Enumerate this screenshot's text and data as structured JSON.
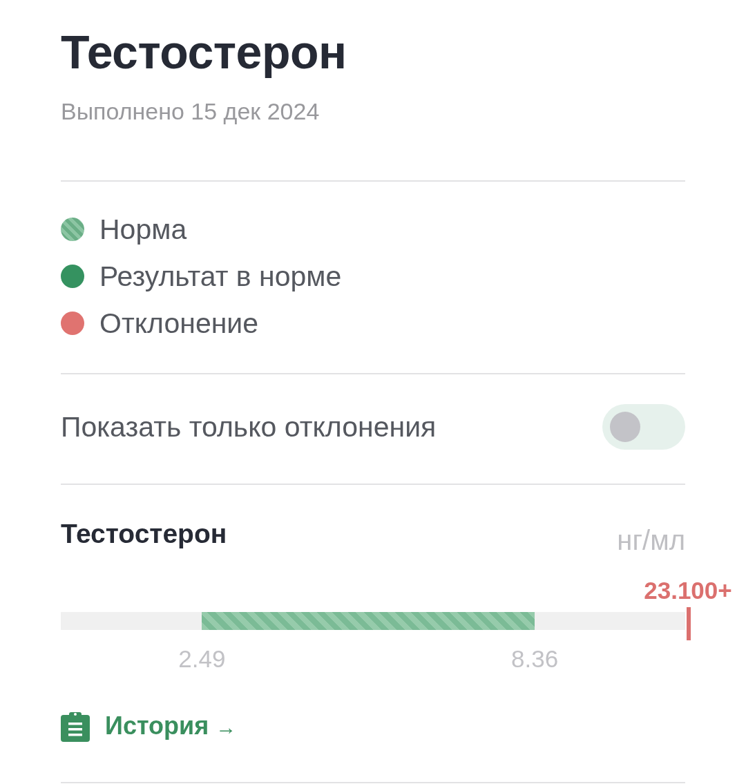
{
  "title": "Тестостерон",
  "subtitle": "Выполнено 15 дек 2024",
  "legend": [
    {
      "label": "Норма",
      "kind": "striped",
      "color": "#8cc5a3"
    },
    {
      "label": "Результат в норме",
      "kind": "solid",
      "color": "#359260"
    },
    {
      "label": "Отклонение",
      "kind": "solid",
      "color": "#e07370"
    }
  ],
  "filter": {
    "label": "Показать только отклонения",
    "on": false
  },
  "results": [
    {
      "name": "Тестостерон",
      "unit": "нг/мл",
      "value": "23.100+",
      "deviation": true,
      "level": 1,
      "range": {
        "low": {
          "label": "2.49",
          "level": 0.226
        },
        "high": {
          "label": "8.36",
          "level": 0.759
        }
      },
      "history": {
        "label": "История",
        "arrow": "→"
      }
    }
  ]
}
